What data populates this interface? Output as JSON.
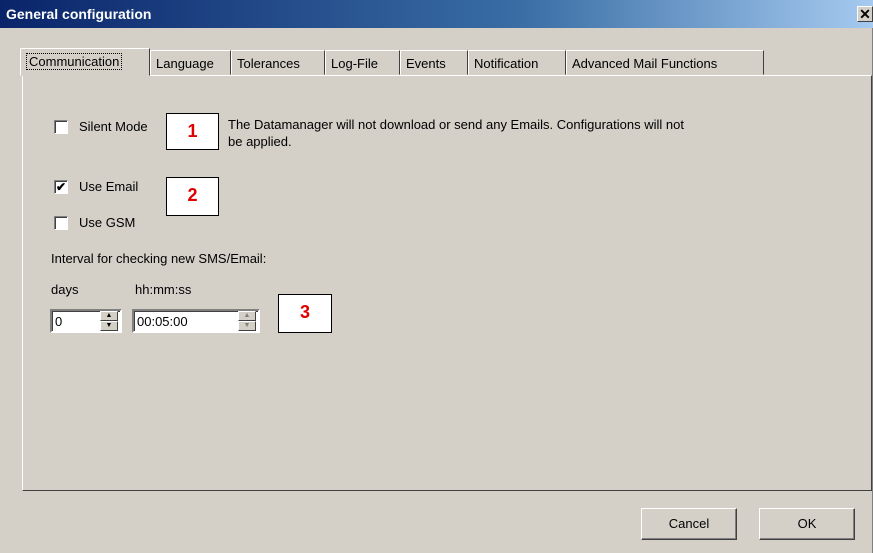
{
  "window": {
    "title": "General configuration",
    "close_glyph": "✕"
  },
  "tabs": [
    {
      "label": "Communication",
      "active": true
    },
    {
      "label": "Language"
    },
    {
      "label": "Tolerances"
    },
    {
      "label": "Log-File"
    },
    {
      "label": "Events"
    },
    {
      "label": "Notification"
    },
    {
      "label": "Advanced Mail Functions"
    }
  ],
  "communication": {
    "silent_mode": {
      "label": "Silent Mode",
      "checked": false
    },
    "silent_mode_desc_line1": "The Datamanager will not download or send any Emails. Configurations will not",
    "silent_mode_desc_line2": "be applied.",
    "use_email": {
      "label": "Use Email",
      "checked": true
    },
    "use_gsm": {
      "label": "Use GSM",
      "checked": false
    },
    "interval_label": "Interval for checking new SMS/Email:",
    "days_label": "days",
    "time_label": "hh:mm:ss",
    "days_value": "0",
    "time_value": "00:05:00"
  },
  "annotations": [
    "1",
    "2",
    "3"
  ],
  "buttons": {
    "cancel": "Cancel",
    "ok": "OK"
  },
  "glyphs": {
    "check": "✔",
    "up": "▲",
    "down": "▼"
  }
}
